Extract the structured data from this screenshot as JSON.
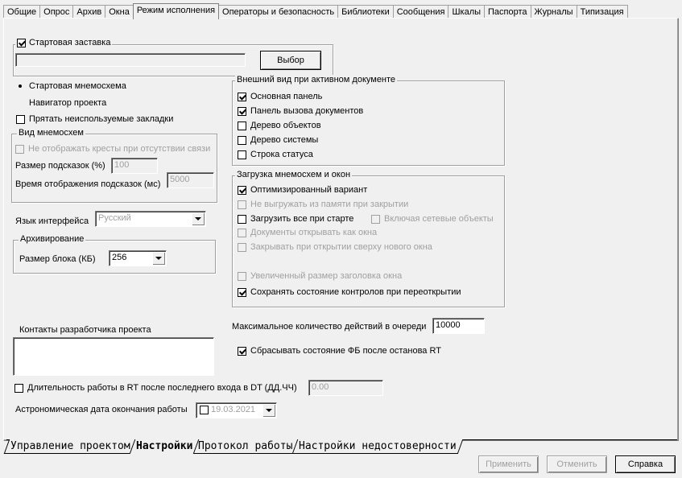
{
  "top_tabs": [
    "Общие",
    "Опрос",
    "Архив",
    "Окна",
    "Режим исполнения",
    "Операторы и безопасность",
    "Библиотеки",
    "Сообщения",
    "Шкалы",
    "Паспорта",
    "Журналы",
    "Типизация"
  ],
  "active_top_tab": "Режим исполнения",
  "startup": {
    "splash_label": "Стартовая заставка",
    "splash_checked": true,
    "splash_path": "",
    "browse_label": "Выбор"
  },
  "radio": {
    "mnemo_label": "Стартовая мнемосхема",
    "navigator_label": "Навигатор проекта"
  },
  "hide_tabs_label": "Прятать неиспользуемые закладки",
  "mnemo_view": {
    "title": "Вид мнемосхем",
    "no_cross_label": "Не отображать кресты при отсутствии связи",
    "hint_size_label": "Размер подсказок (%)",
    "hint_size_value": "100",
    "hint_time_label": "Время отображения подсказок (мс)",
    "hint_time_value": "5000"
  },
  "language": {
    "label": "Язык интерфейса",
    "value": "Русский"
  },
  "archiving": {
    "title": "Архивирование",
    "block_label": "Размер блока (КБ)",
    "block_value": "256"
  },
  "appearance": {
    "title": "Внешний вид при активном документе",
    "items": [
      {
        "label": "Основная панель",
        "checked": true
      },
      {
        "label": "Панель вызова документов",
        "checked": true
      },
      {
        "label": "Дерево объектов",
        "checked": false
      },
      {
        "label": "Дерево системы",
        "checked": false
      },
      {
        "label": "Строка статуса",
        "checked": false
      }
    ]
  },
  "loading": {
    "title": "Загрузка мнемосхем и окон",
    "optimized": "Оптимизированный вариант",
    "no_unload": "Не выгружать из памяти при закрытии",
    "load_all": "Загрузить все при старте",
    "include_network": "Включая сетевые объекты",
    "docs_as_windows": "Документы открывать как окна",
    "close_on_open": "Закрывать при открытии сверху нового окна",
    "big_title": "Увеличенный размер заголовка окна",
    "save_state": "Сохранять состояние контролов при переоткрытии"
  },
  "queue": {
    "label": "Максимальное количество действий в очереди",
    "value": "10000"
  },
  "reset_fb_label": "Сбрасывать состояние ФБ после останова RT",
  "contacts": {
    "title": "Контакты разработчика проекта",
    "value": ""
  },
  "rt_duration": {
    "label": "Длительность работы в RT после последнего входа в DT (ДД.ЧЧ)",
    "value": "0.00"
  },
  "astro_date": {
    "label": "Астрономическая дата окончания работы",
    "value": "19.03.2021"
  },
  "bottom_tabs": [
    "Управление проектом",
    "Настройки",
    "Протокол работы",
    "Настройки недостоверности"
  ],
  "active_bottom_tab": "Настройки",
  "buttons": {
    "apply": "Применить",
    "cancel": "Отменить",
    "help": "Справка"
  }
}
